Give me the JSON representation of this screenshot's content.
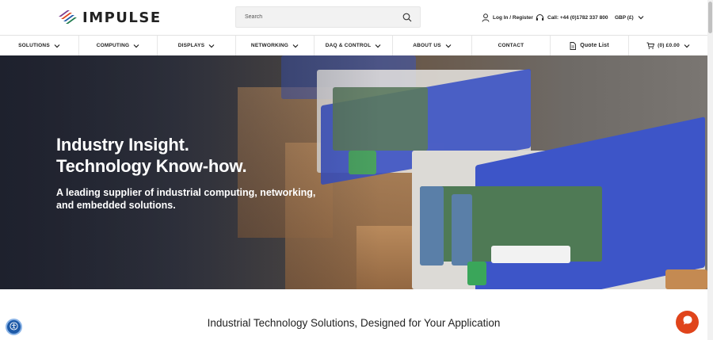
{
  "brand": {
    "name": "IMPULSE",
    "colors": [
      "#1f7a4d",
      "#1e5aa8",
      "#e0441b",
      "#7c3d8f"
    ]
  },
  "search": {
    "placeholder": "Search"
  },
  "utils": {
    "login_label": "Log In / Register",
    "call_label": "Call: +44 (0)1782 337 800",
    "currency_label": "GBP (£)"
  },
  "nav": {
    "items": [
      {
        "label": "SOLUTIONS"
      },
      {
        "label": "COMPUTING"
      },
      {
        "label": "DISPLAYS"
      },
      {
        "label": "NETWORKING"
      },
      {
        "label": "DAQ & CONTROL"
      },
      {
        "label": "ABOUT US"
      },
      {
        "label": "CONTACT"
      },
      {
        "label": "Quote List"
      },
      {
        "label": "(0) £0.00"
      }
    ]
  },
  "hero": {
    "title_line1": "Industry Insight.",
    "title_line2": "Technology Know-how.",
    "subtitle": "A leading supplier of industrial computing, networking, and embedded solutions."
  },
  "section": {
    "title": "Industrial Technology Solutions, Designed for Your Application"
  },
  "icons": {
    "search": "search-icon",
    "user": "user-icon",
    "headset": "headset-icon",
    "chevron": "chevron-down-icon",
    "quote": "document-icon",
    "cart": "cart-icon",
    "accessibility": "accessibility-icon",
    "chat": "chat-icon"
  }
}
